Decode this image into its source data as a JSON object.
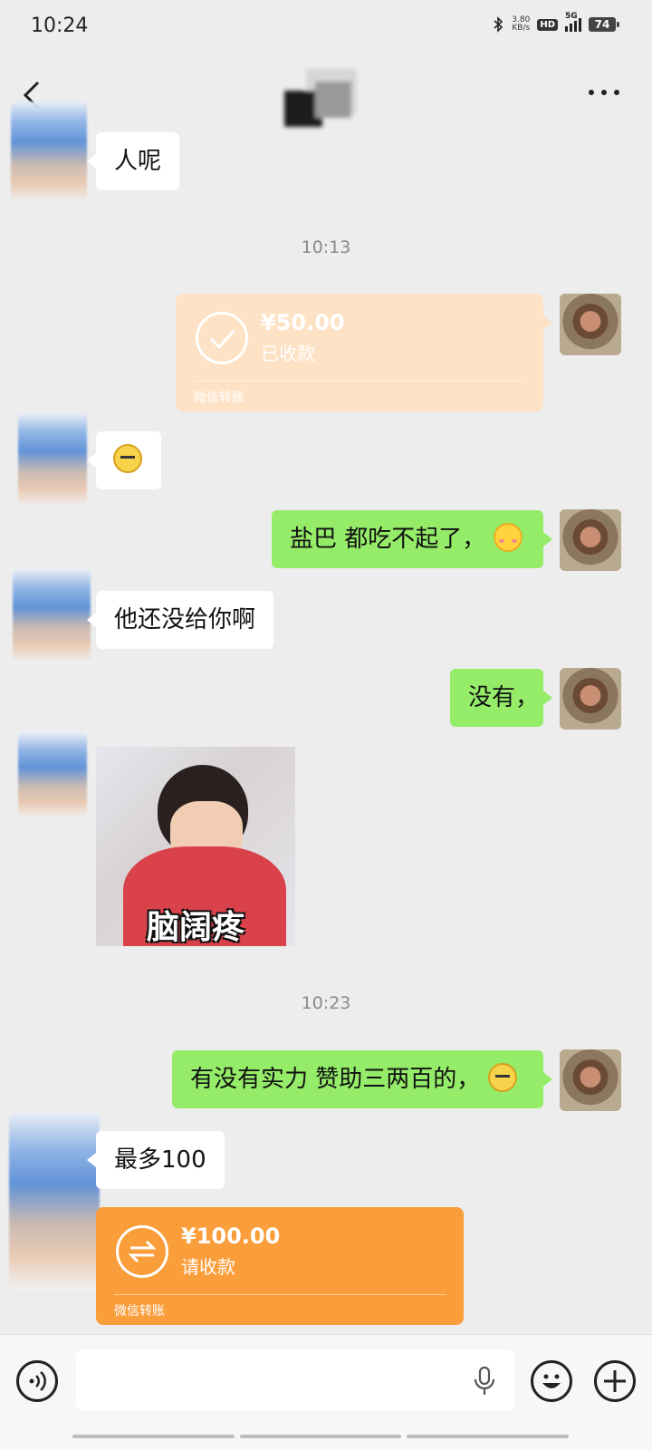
{
  "status_bar": {
    "time": "10:24",
    "net_speed_value": "3.80",
    "net_speed_unit": "KB/s",
    "hd_label": "HD",
    "network": "5G",
    "battery": "74"
  },
  "header": {
    "back_icon": "chevron-left-icon",
    "more_icon": "more-dots-icon"
  },
  "messages": [
    {
      "side": "left",
      "type": "text",
      "text": "人呢"
    },
    {
      "type": "timestamp",
      "text": "10:13"
    },
    {
      "side": "right",
      "type": "transfer",
      "amount": "¥50.00",
      "status": "已收款",
      "footer": "微信转账",
      "color": "#fde2c6"
    },
    {
      "side": "left",
      "type": "emoji",
      "emoji": "cat-emoji"
    },
    {
      "side": "right",
      "type": "text",
      "text": "盐巴 都吃不起了，",
      "emoji": "blush-emoji"
    },
    {
      "side": "left",
      "type": "text",
      "text": "他还没给你啊"
    },
    {
      "side": "right",
      "type": "text",
      "text": "没有，"
    },
    {
      "side": "left",
      "type": "sticker",
      "caption": "脑阔疼"
    },
    {
      "type": "timestamp",
      "text": "10:23"
    },
    {
      "side": "right",
      "type": "text",
      "text": "有没有实力 赞助三两百的，",
      "emoji": "cat-emoji"
    },
    {
      "side": "left",
      "type": "text",
      "text": "最多100"
    },
    {
      "side": "left",
      "type": "transfer",
      "amount": "¥100.00",
      "status": "请收款",
      "footer": "微信转账",
      "color": "#fa9d3b"
    }
  ],
  "input_bar": {
    "voice_icon": "voice-icon",
    "mic_icon": "mic-icon",
    "emoji_icon": "smiley-icon",
    "plus_icon": "plus-icon",
    "input_value": ""
  },
  "colors": {
    "background": "#ededed",
    "self_bubble": "#95ec69",
    "other_bubble": "#ffffff",
    "transfer_received": "#fde2c6",
    "transfer_pending": "#fa9d3b"
  }
}
